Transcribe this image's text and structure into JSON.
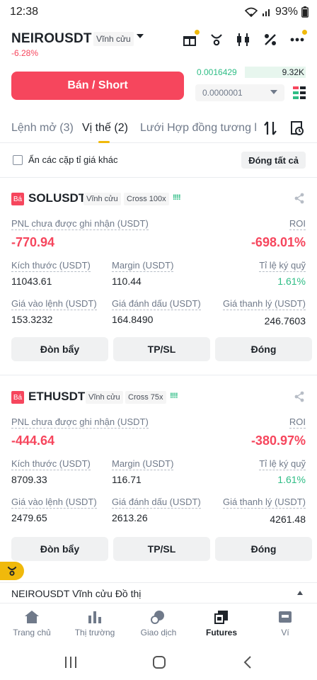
{
  "status": {
    "time": "12:38",
    "battery": "93%"
  },
  "header": {
    "symbol": "NEIROUSDT",
    "contract_type": "Vĩnh cửu",
    "change": "-6.28%"
  },
  "trade": {
    "sell_label": "Bán / Short",
    "orderbook_price": "0.0016429",
    "orderbook_qty": "9.32K",
    "precision": "0.0000001"
  },
  "tabs": {
    "open_orders": "Lệnh mở (3)",
    "positions": "Vị thế (2)",
    "grid": "Lưới Hợp đồng tương la"
  },
  "filter": {
    "hide_label": "Ẩn các cặp tỉ giá khác",
    "close_all": "Đóng tất cả"
  },
  "labels": {
    "side": "Bá",
    "pnl": "PNL chưa được ghi nhận (USDT)",
    "roi": "ROI",
    "size": "Kích thước (USDT)",
    "margin": "Margin (USDT)",
    "margin_ratio": "Tỉ lệ ký quỹ",
    "entry": "Giá vào lệnh (USDT)",
    "mark": "Giá đánh dấu (USDT)",
    "liq": "Giá thanh lý (USDT)",
    "leverage_btn": "Đòn bẩy",
    "tpsl_btn": "TP/SL",
    "close_btn": "Đóng",
    "bars": "!!!!"
  },
  "positions": [
    {
      "symbol": "SOLUSDT",
      "type": "Vĩnh cửu",
      "mode": "Cross 100x",
      "pnl": "-770.94",
      "roi": "-698.01%",
      "size": "11043.61",
      "margin": "110.44",
      "margin_ratio": "1.61%",
      "entry": "153.3232",
      "mark": "164.8490",
      "liq": "246.7603"
    },
    {
      "symbol": "ETHUSDT",
      "type": "Vĩnh cửu",
      "mode": "Cross 75x",
      "pnl": "-444.64",
      "roi": "-380.97%",
      "size": "8709.33",
      "margin": "116.71",
      "margin_ratio": "1.61%",
      "entry": "2479.65",
      "mark": "2613.26",
      "liq": "4261.48"
    }
  ],
  "chartbar": {
    "title": "NEIROUSDT Vĩnh cửu Đồ thị"
  },
  "nav": {
    "home": "Trang chủ",
    "markets": "Thị trường",
    "trade": "Giao dịch",
    "futures": "Futures",
    "wallet": "Ví"
  },
  "colors": {
    "sell": "#f6465d",
    "buy": "#2ebd85",
    "accent": "#f0b90b"
  }
}
